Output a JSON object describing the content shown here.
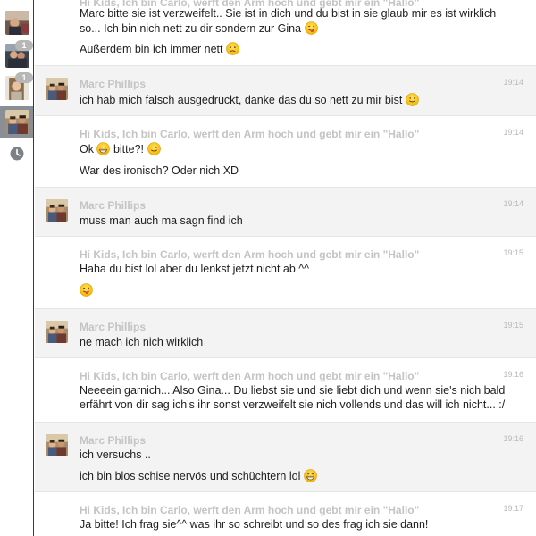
{
  "sidebar": {
    "badges": [
      "1",
      "1"
    ]
  },
  "messages": [
    {
      "sender": "Hi Kids, Ich bin Carlo, werft den Arm hoch und gebt mir ein \"Hallo\"",
      "time": "",
      "lines": [
        "Marc bitte sie ist verzweifelt.. Sie ist in dich und du bist in sie glaub mir es ist wirklich",
        "so... Ich bin nich nett zu dir sondern zur Gina",
        "Außerdem bin ich immer nett"
      ]
    },
    {
      "sender": "Marc Phillips",
      "time": "19:14",
      "lines": [
        "ich hab mich falsch ausgedrückt, danke das du so nett zu mir bist"
      ]
    },
    {
      "sender": "Hi Kids, Ich bin Carlo, werft den Arm hoch und gebt mir ein \"Hallo\"",
      "time": "19:14",
      "lines": [
        "Ok",
        "bitte?!",
        "War des ironisch? Oder nich XD"
      ]
    },
    {
      "sender": "Marc Phillips",
      "time": "19:14",
      "lines": [
        "muss man auch ma sagn find ich"
      ]
    },
    {
      "sender": "Hi Kids, Ich bin Carlo, werft den Arm hoch und gebt mir ein \"Hallo\"",
      "time": "19:15",
      "lines": [
        "Haha du bist lol aber du lenkst jetzt nicht ab ^^"
      ]
    },
    {
      "sender": "Marc Phillips",
      "time": "19:15",
      "lines": [
        "ne mach ich nich wirklich"
      ]
    },
    {
      "sender": "Hi Kids, Ich bin Carlo, werft den Arm hoch und gebt mir ein \"Hallo\"",
      "time": "19:16",
      "lines": [
        "Neeeein garnich... Also Gina... Du liebst sie und sie liebt dich und wenn sie's nich bald",
        "erfährt von dir sag ich's ihr sonst verzweifelt sie nich vollends und das will ich nicht... :/"
      ]
    },
    {
      "sender": "Marc Phillips",
      "time": "19:16",
      "lines": [
        "ich versuchs ..",
        "ich bin blos schise nervös und schüchtern lol"
      ]
    },
    {
      "sender": "Hi Kids, Ich bin Carlo, werft den Arm hoch und gebt mir ein \"Hallo\"",
      "time": "19:17",
      "lines": [
        "Ja bitte! Ich frag sie^^ was ihr so schreibt und so des frag ich sie dann!"
      ]
    }
  ]
}
